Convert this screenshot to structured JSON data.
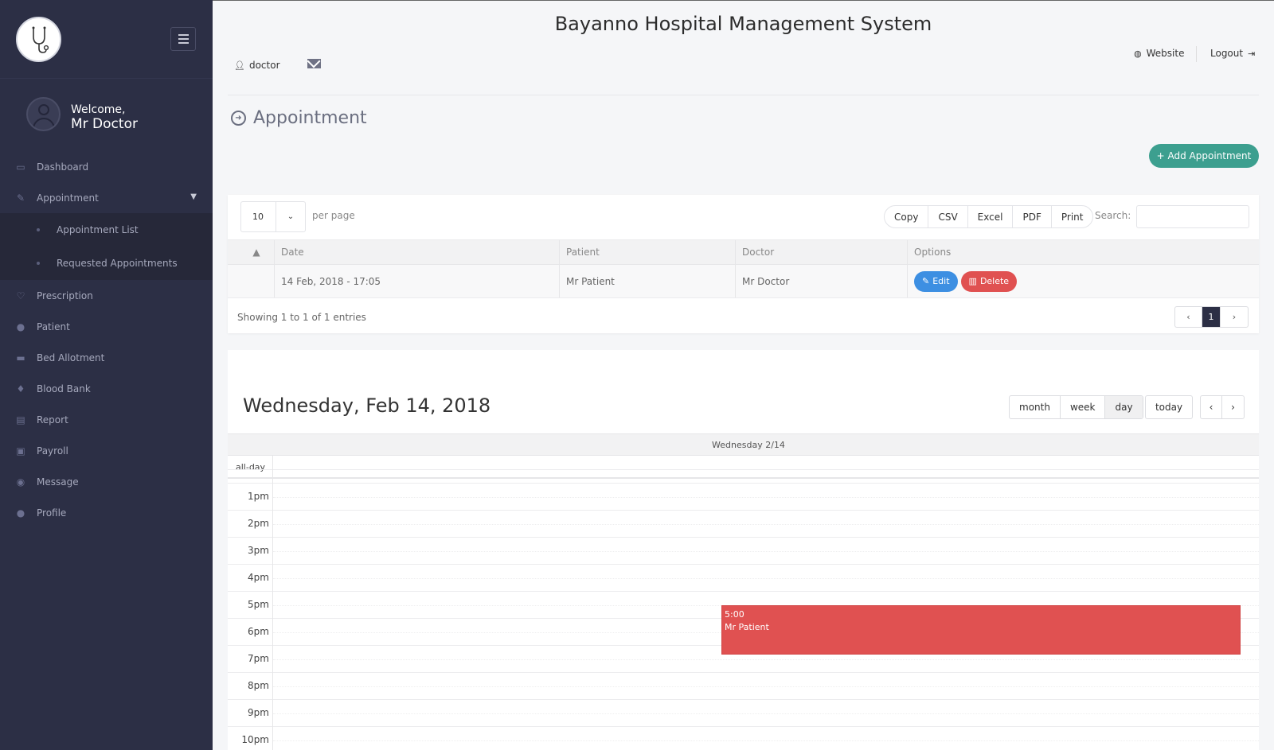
{
  "app": {
    "title": "Bayanno Hospital Management System",
    "user_label": "doctor",
    "website_label": "Website",
    "logout_label": "Logout"
  },
  "sidebar": {
    "welcome": "Welcome,",
    "user_name": "Mr Doctor",
    "items": [
      {
        "label": "Dashboard",
        "icon": "monitor-icon"
      },
      {
        "label": "Appointment",
        "icon": "edit-icon"
      },
      {
        "label": "Prescription",
        "icon": "stethoscope-icon"
      },
      {
        "label": "Patient",
        "icon": "user-icon"
      },
      {
        "label": "Bed Allotment",
        "icon": "bed-icon"
      },
      {
        "label": "Blood Bank",
        "icon": "drop-icon"
      },
      {
        "label": "Report",
        "icon": "clipboard-icon"
      },
      {
        "label": "Payroll",
        "icon": "money-icon"
      },
      {
        "label": "Message",
        "icon": "chat-icon"
      },
      {
        "label": "Profile",
        "icon": "user-icon"
      }
    ],
    "sub_items": [
      {
        "label": "Appointment List"
      },
      {
        "label": "Requested Appointments"
      }
    ]
  },
  "page": {
    "title": "Appointment",
    "add_button": "+ Add Appointment"
  },
  "table": {
    "per_page_value": "10",
    "per_page_label": "per page",
    "export_buttons": [
      "Copy",
      "CSV",
      "Excel",
      "PDF",
      "Print"
    ],
    "search_label": "Search:",
    "search_value": "",
    "columns": [
      "Date",
      "Patient",
      "Doctor",
      "Options"
    ],
    "rows": [
      {
        "date": "14 Feb, 2018 - 17:05",
        "patient": "Mr Patient",
        "doctor": "Mr Doctor",
        "edit": "Edit",
        "delete": "Delete"
      }
    ],
    "showing": "Showing 1 to 1 of 1 entries",
    "pager": {
      "prev": "‹",
      "current": "1",
      "next": "›"
    }
  },
  "calendar": {
    "title": "Wednesday, Feb 14, 2018",
    "views": [
      "month",
      "week",
      "day"
    ],
    "selected_view": "day",
    "today_label": "today",
    "prev": "‹",
    "next": "›",
    "column_header": "Wednesday 2/14",
    "allday_label": "all-day",
    "hours": [
      "1pm",
      "2pm",
      "3pm",
      "4pm",
      "5pm",
      "6pm",
      "7pm",
      "8pm",
      "9pm",
      "10pm"
    ],
    "event": {
      "time": "5:00",
      "title": "Mr Patient",
      "color": "#e05151"
    }
  },
  "colors": {
    "sidebar_bg": "#2c2f45",
    "accent_teal": "#3c9f8f",
    "edit_blue": "#3d8fe2",
    "delete_red": "#e05151"
  }
}
